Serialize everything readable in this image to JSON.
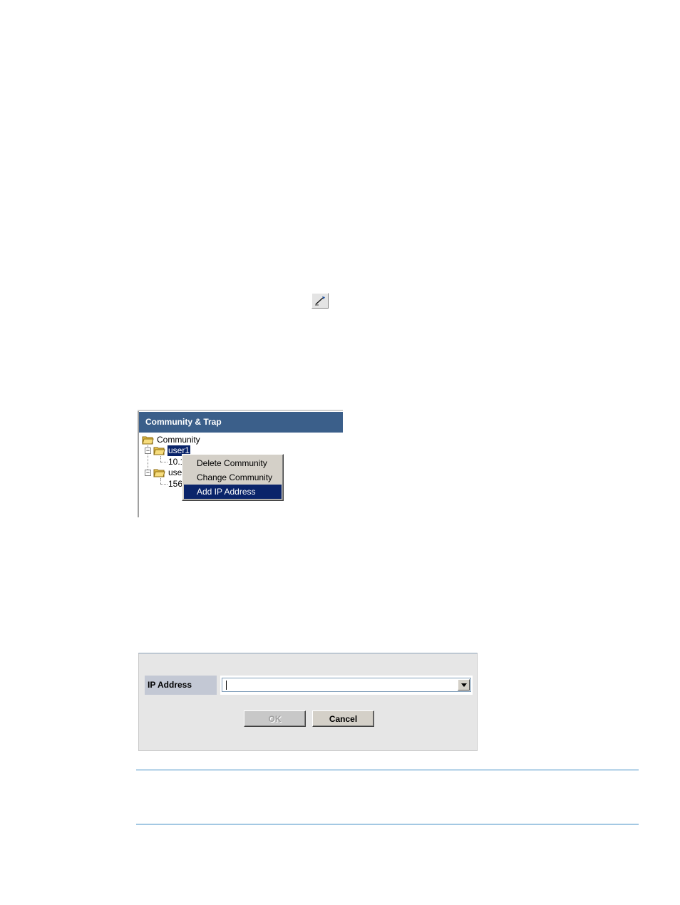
{
  "toolbar_icon": {
    "name": "edit-pencil-icon"
  },
  "community_panel": {
    "title": "Community & Trap",
    "tree": {
      "root_label": "Community",
      "nodes": [
        {
          "label": "user1",
          "selected": true,
          "child_label": "10.1"
        },
        {
          "label": "use",
          "selected": false,
          "child_label": "156"
        }
      ]
    }
  },
  "context_menu": {
    "items": [
      {
        "label": "Delete Community",
        "active": false
      },
      {
        "label": "Change Community",
        "active": false
      },
      {
        "label": "Add IP Address",
        "active": true
      }
    ]
  },
  "ip_dialog": {
    "field_label": "IP Address",
    "field_value": "",
    "ok_label": "OK",
    "cancel_label": "Cancel",
    "ok_enabled": false
  },
  "colors": {
    "panel_header": "#3b5f8a",
    "selection": "#0a246a",
    "note_rule": "#3a89c2"
  }
}
